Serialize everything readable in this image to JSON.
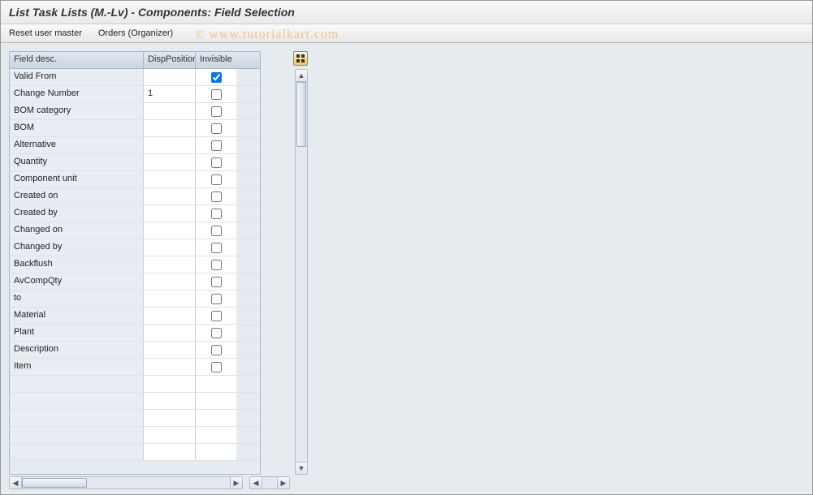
{
  "header": {
    "title": "List Task Lists (M.-Lv) - Components: Field Selection"
  },
  "toolbar": {
    "reset_label": "Reset user master",
    "orders_label": "Orders (Organizer)"
  },
  "watermark": "www.tutorialkart.com",
  "table": {
    "columns": {
      "desc": "Field desc.",
      "pos": "DispPosition",
      "inv": "Invisible"
    },
    "rows": [
      {
        "desc": "Valid From",
        "pos": "",
        "inv": true
      },
      {
        "desc": "Change Number",
        "pos": "1",
        "inv": false
      },
      {
        "desc": "BOM category",
        "pos": "",
        "inv": false
      },
      {
        "desc": "BOM",
        "pos": "",
        "inv": false
      },
      {
        "desc": "Alternative",
        "pos": "",
        "inv": false
      },
      {
        "desc": "Quantity",
        "pos": "",
        "inv": false
      },
      {
        "desc": "Component unit",
        "pos": "",
        "inv": false
      },
      {
        "desc": "Created on",
        "pos": "",
        "inv": false
      },
      {
        "desc": "Created by",
        "pos": "",
        "inv": false
      },
      {
        "desc": "Changed on",
        "pos": "",
        "inv": false
      },
      {
        "desc": "Changed by",
        "pos": "",
        "inv": false
      },
      {
        "desc": "Backflush",
        "pos": "",
        "inv": false
      },
      {
        "desc": "AvCompQty",
        "pos": "",
        "inv": false
      },
      {
        "desc": "to",
        "pos": "",
        "inv": false
      },
      {
        "desc": "Material",
        "pos": "",
        "inv": false
      },
      {
        "desc": "Plant",
        "pos": "",
        "inv": false
      },
      {
        "desc": "Description",
        "pos": "",
        "inv": false
      },
      {
        "desc": "Item",
        "pos": "",
        "inv": false
      }
    ],
    "empty_rows": 5
  }
}
